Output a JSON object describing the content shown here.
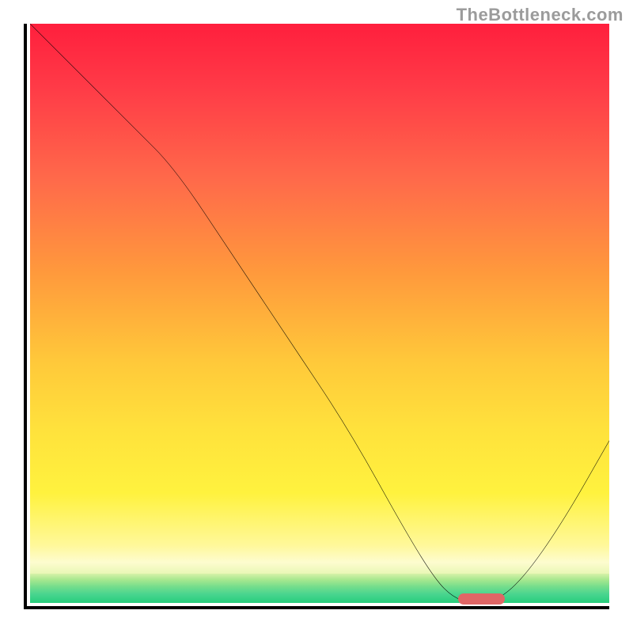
{
  "watermark": "TheBottleneck.com",
  "chart_data": {
    "type": "line",
    "title": "",
    "xlabel": "",
    "ylabel": "",
    "xlim": [
      0,
      100
    ],
    "ylim": [
      0,
      100
    ],
    "grid": false,
    "background_gradient": {
      "stops": [
        {
          "pos": 0,
          "color": "#ff1f3d"
        },
        {
          "pos": 30,
          "color": "#ff6a4a"
        },
        {
          "pos": 60,
          "color": "#ffc93a"
        },
        {
          "pos": 85,
          "color": "#fff23e"
        },
        {
          "pos": 92,
          "color": "#fdfccf"
        },
        {
          "pos": 100,
          "color": "#27cd7c"
        }
      ]
    },
    "series": [
      {
        "name": "bottleneck-curve",
        "color": "#000000",
        "x": [
          0,
          8,
          18,
          25,
          35,
          45,
          55,
          65,
          70,
          73,
          76,
          80,
          85,
          92,
          100
        ],
        "y": [
          100,
          92,
          82,
          75,
          60,
          45,
          30,
          12,
          4,
          1,
          0,
          0,
          4,
          14,
          28
        ]
      }
    ],
    "marker": {
      "name": "optimal-range",
      "x_start": 74,
      "x_end": 82,
      "y": 0,
      "color": "#e06666"
    }
  }
}
